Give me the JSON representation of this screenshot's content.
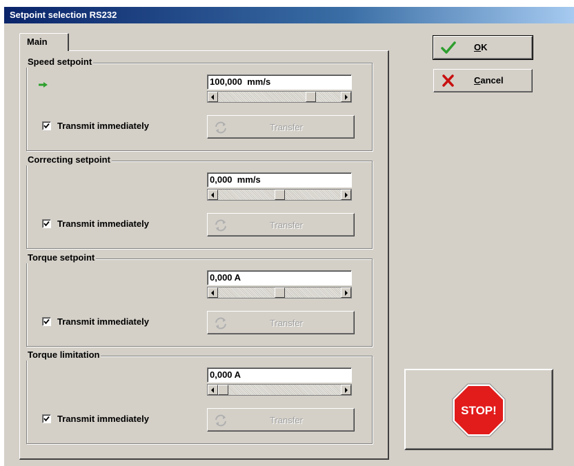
{
  "window": {
    "title": "Setpoint selection RS232"
  },
  "tabs": [
    {
      "label": "Main"
    }
  ],
  "groups": [
    {
      "title": "Speed setpoint",
      "value": "100,000  mm/s",
      "has_arrow_icon": true,
      "checkbox_label": "Transmit immediately",
      "checkbox_checked": true,
      "transfer_label": "Transfer",
      "slider_position": 0.78
    },
    {
      "title": "Correcting setpoint",
      "value": "0,000  mm/s",
      "checkbox_label": "Transmit immediately",
      "checkbox_checked": true,
      "transfer_label": "Transfer",
      "slider_position": 0.5
    },
    {
      "title": "Torque setpoint",
      "value": "0,000 A",
      "checkbox_label": "Transmit immediately",
      "checkbox_checked": true,
      "transfer_label": "Transfer",
      "slider_position": 0.5
    },
    {
      "title": "Torque limitation",
      "value": "0,000 A",
      "checkbox_label": "Transmit immediately",
      "checkbox_checked": true,
      "transfer_label": "Transfer",
      "slider_position": 0.0
    }
  ],
  "buttons": {
    "ok": {
      "label_underlined": "O",
      "label_rest": "K",
      "icon": "green-check-icon"
    },
    "cancel": {
      "label_underlined": "C",
      "label_rest": "ancel",
      "icon": "red-x-icon"
    },
    "stop": {
      "label": "STOP!",
      "icon": "stop-sign-icon"
    }
  },
  "colors": {
    "title_bar": "#0a246a",
    "window_bg": "#d4d0c8",
    "stop_red": "#e21b1b",
    "ok_green": "#2e9e2e",
    "cancel_red": "#c81010"
  }
}
